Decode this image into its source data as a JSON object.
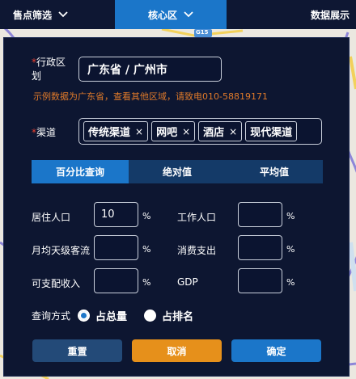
{
  "topbar": {
    "filter_label": "售点筛选",
    "core_label": "核心区",
    "data_label": "数据展示"
  },
  "map": {
    "road_marker": "G15"
  },
  "region": {
    "label": "行政区划",
    "required_mark": "*",
    "value": "广东省 / 广州市",
    "notice": "示例数据为广东省，查看其他区域，请致电010-58819171"
  },
  "channel": {
    "label": "渠道",
    "required_mark": "*",
    "tags": [
      "传统渠道",
      "网吧",
      "酒店",
      "现代渠道"
    ],
    "remove_glyph": "×"
  },
  "tabs": [
    "百分比查询",
    "绝对值",
    "平均值"
  ],
  "metrics": {
    "unit": "%",
    "resident_pop": {
      "label": "居住人口",
      "value": "10"
    },
    "working_pop": {
      "label": "工作人口",
      "value": ""
    },
    "daily_traffic": {
      "label": "月均天级客流",
      "value": ""
    },
    "consumption": {
      "label": "消费支出",
      "value": ""
    },
    "disposable_income": {
      "label": "可支配收入",
      "value": ""
    },
    "gdp": {
      "label": "GDP",
      "value": ""
    }
  },
  "query_mode": {
    "label": "查询方式",
    "options": [
      "占总量",
      "占排名"
    ]
  },
  "buttons": {
    "reset": "重置",
    "cancel": "取消",
    "confirm": "确定"
  },
  "colors": {
    "accent": "#1b76c9",
    "cancel": "#e6901b",
    "notice": "#e07a2a",
    "panel": "#0d1631"
  }
}
